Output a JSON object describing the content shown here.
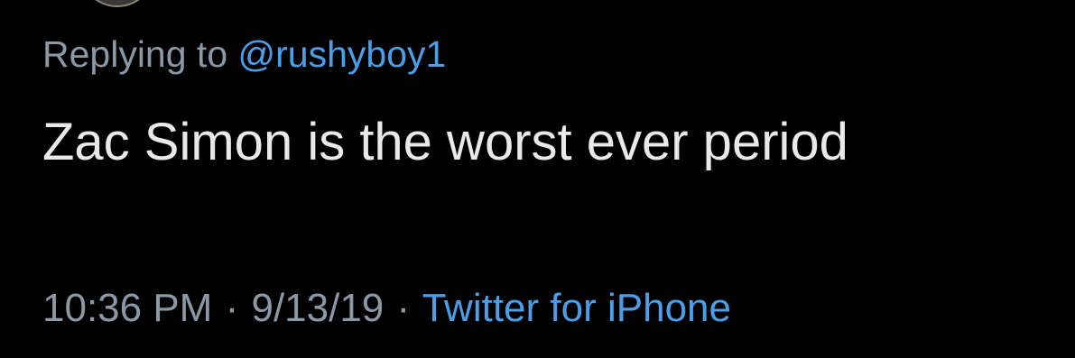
{
  "reply": {
    "prefix": "Replying to",
    "handle": "@rushyboy1"
  },
  "tweet": {
    "text": "Zac Simon is the worst ever period"
  },
  "meta": {
    "time": "10:36 PM",
    "separator": "·",
    "date": "9/13/19",
    "source": "Twitter for iPhone"
  },
  "colors": {
    "background": "#000000",
    "text": "#e7e9ea",
    "muted": "#8b98a5",
    "accent": "#4a9fe8"
  }
}
